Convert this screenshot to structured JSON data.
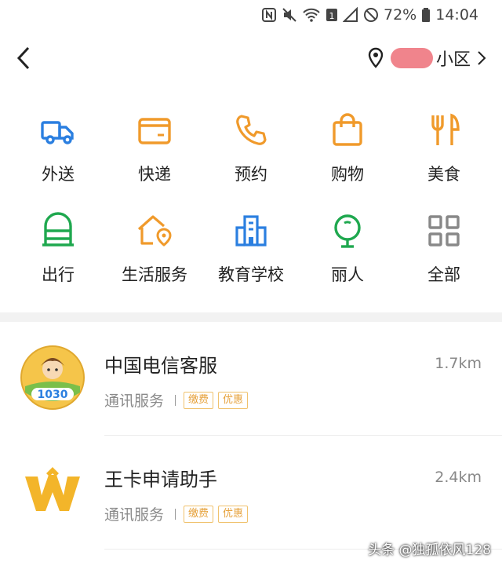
{
  "status_bar": {
    "battery": "72%",
    "time": "14:04"
  },
  "header": {
    "location_text": "小区"
  },
  "categories": [
    {
      "label": "外送",
      "icon": "delivery-truck-icon",
      "color": "#2b7fe0"
    },
    {
      "label": "快递",
      "icon": "parcel-box-icon",
      "color": "#f09a2b"
    },
    {
      "label": "预约",
      "icon": "phone-icon",
      "color": "#f09a2b"
    },
    {
      "label": "购物",
      "icon": "shopping-bag-icon",
      "color": "#f09a2b"
    },
    {
      "label": "美食",
      "icon": "fork-knife-icon",
      "color": "#f09a2b"
    },
    {
      "label": "出行",
      "icon": "bus-icon",
      "color": "#1fa84f"
    },
    {
      "label": "生活服务",
      "icon": "home-location-icon",
      "color": "#f09a2b"
    },
    {
      "label": "教育学校",
      "icon": "school-building-icon",
      "color": "#2b7fe0"
    },
    {
      "label": "丽人",
      "icon": "mirror-icon",
      "color": "#1fa84f"
    },
    {
      "label": "全部",
      "icon": "grid-icon",
      "color": "#888888"
    }
  ],
  "list": [
    {
      "title": "中国电信客服",
      "distance": "1.7km",
      "category": "通讯服务",
      "tags": [
        "缴费",
        "优惠"
      ]
    },
    {
      "title": "王卡申请助手",
      "distance": "2.4km",
      "category": "通讯服务",
      "tags": [
        "缴费",
        "优惠"
      ]
    }
  ],
  "watermark": "头条 @独孤依风128"
}
